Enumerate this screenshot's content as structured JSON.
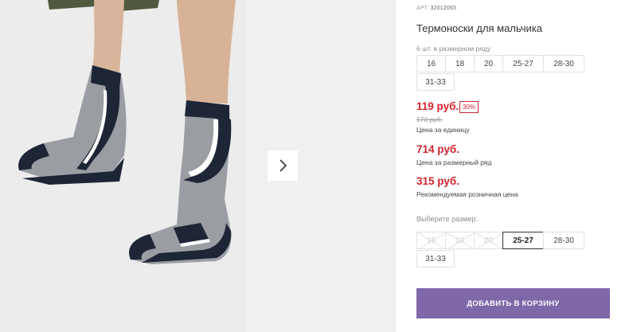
{
  "product": {
    "article_label": "АРТ.",
    "article_number": "32012065",
    "title": "Термоноски для мальчика"
  },
  "pack": {
    "hint": "6 шт. в размерном ряду",
    "sizes": [
      "16",
      "18",
      "20",
      "25-27",
      "28-30",
      "31-33"
    ]
  },
  "prices": {
    "unit_price": "119 руб.",
    "discount_badge": "30%",
    "old_price": "170 руб.",
    "unit_label": "Цена за единицу",
    "set_price": "714 руб.",
    "set_label": "Цена за размерный ряд",
    "retail_price": "315 руб.",
    "retail_label": "Рекомендуемая розничная цена"
  },
  "size_select": {
    "hint": "Выберите размер:",
    "options": [
      {
        "label": "16",
        "state": "disabled"
      },
      {
        "label": "18",
        "state": "disabled"
      },
      {
        "label": "20",
        "state": "disabled"
      },
      {
        "label": "25-27",
        "state": "selected"
      },
      {
        "label": "28-30",
        "state": "available"
      },
      {
        "label": "31-33",
        "state": "available"
      }
    ]
  },
  "cart_button": "ДОБАВИТЬ В КОРЗИНУ",
  "colors": {
    "price_red": "#d1252e",
    "button_purple": "#7e68a8",
    "sock_navy": "#1d2536",
    "sock_grey": "#9a9ea3"
  }
}
